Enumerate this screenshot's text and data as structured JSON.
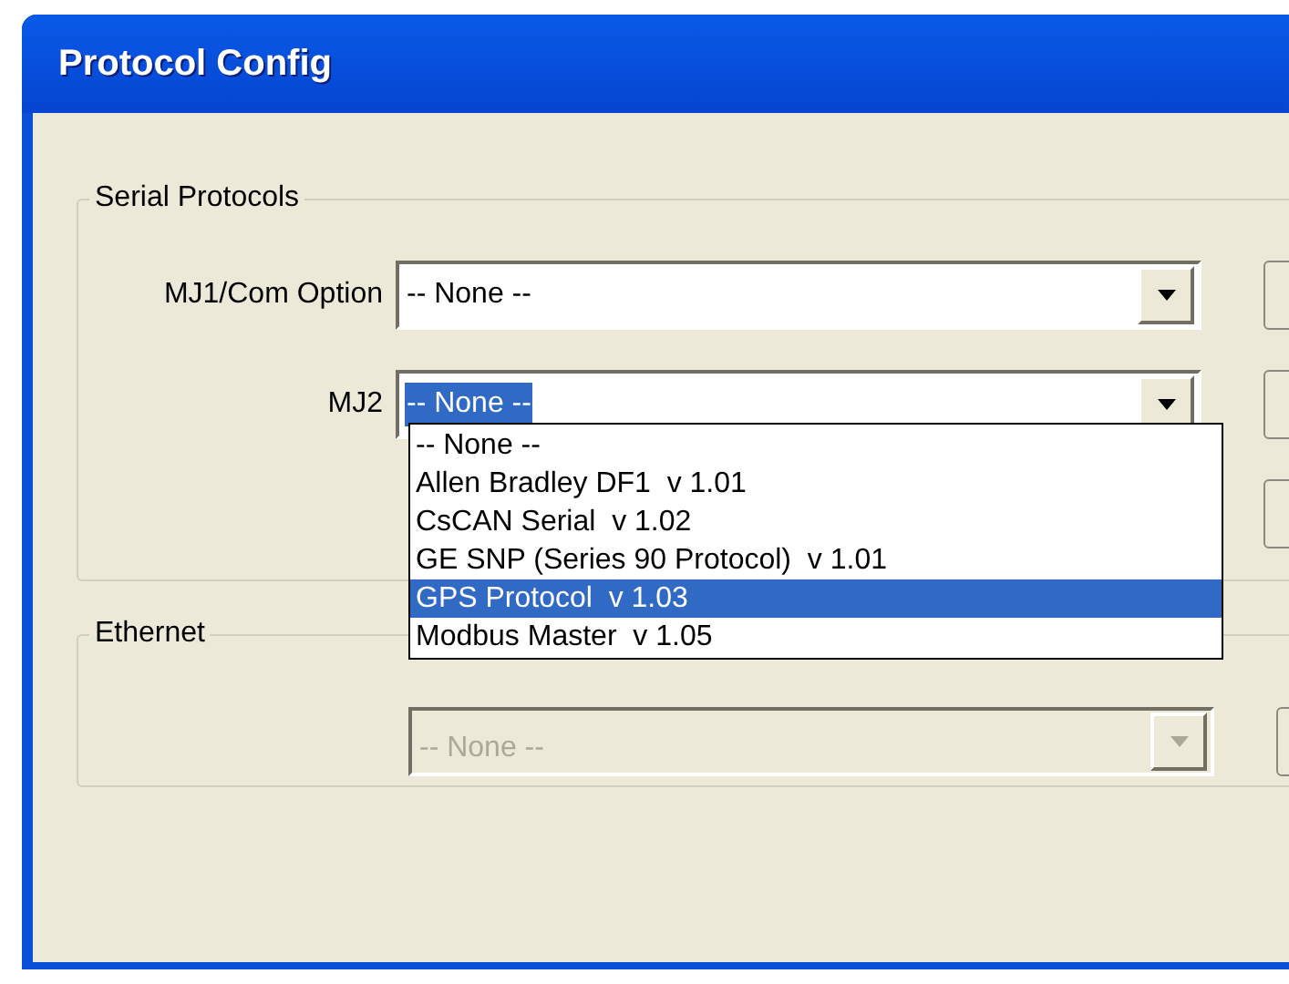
{
  "window": {
    "title": "Protocol Config"
  },
  "serial_protocols": {
    "title": "Serial Protocols",
    "fields": [
      {
        "label": "MJ1/Com Option",
        "value": "-- None --",
        "focused": false
      },
      {
        "label": "MJ2",
        "value": "-- None --",
        "focused": true
      }
    ]
  },
  "dropdown": {
    "options": [
      {
        "label": "-- None --",
        "selected": false
      },
      {
        "label": "Allen Bradley DF1  v 1.01",
        "selected": false
      },
      {
        "label": "CsCAN Serial  v 1.02",
        "selected": false
      },
      {
        "label": "GE SNP (Series 90 Protocol)  v 1.01",
        "selected": false
      },
      {
        "label": "GPS Protocol  v 1.03",
        "selected": true
      },
      {
        "label": "Modbus Master  v 1.05",
        "selected": false
      }
    ]
  },
  "ethernet": {
    "title": "Ethernet",
    "field": {
      "value": "-- None --",
      "disabled": true
    }
  }
}
